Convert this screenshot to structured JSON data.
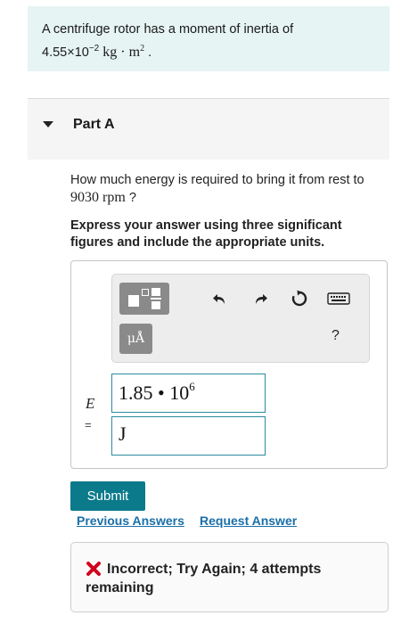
{
  "problem": {
    "text_prefix": "A centrifuge rotor has a moment of inertia of",
    "mantissa": "4.55",
    "times_ten": "×10",
    "exponent": "−2",
    "unit_base": "kg · m",
    "unit_exp": "2",
    "period": "."
  },
  "part": {
    "title": "Part A"
  },
  "question": {
    "text": "How much energy is required to bring it from rest to",
    "value": "9030",
    "unit": "rpm",
    "end": "?"
  },
  "instruction": "Express your answer using three significant figures and include the appropriate units.",
  "toolbar": {
    "units_label": "μÅ",
    "help_label": "?",
    "icons": [
      "templates-icon",
      "undo-icon",
      "redo-icon",
      "reset-icon",
      "keyboard-icon"
    ]
  },
  "answer": {
    "variable": "E",
    "equals": "=",
    "value_base": "1.85 • 10",
    "value_exp": "6",
    "unit": "J"
  },
  "actions": {
    "submit_label": "Submit",
    "previous_answers_label": "Previous Answers",
    "request_answer_label": "Request Answer"
  },
  "feedback": {
    "text": "Incorrect; Try Again; 4 attempts remaining",
    "status_color": "#d0021b"
  },
  "colors": {
    "accent": "#0b7a8a",
    "link": "#1a6fa8",
    "problem_bg": "#e6f4f3"
  }
}
